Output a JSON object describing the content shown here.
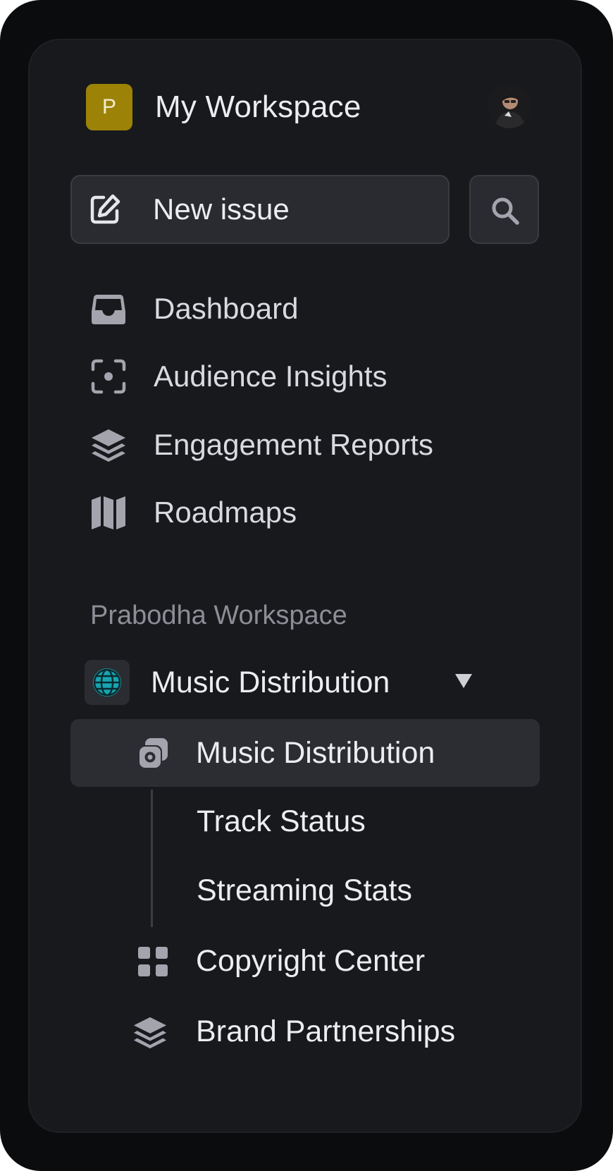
{
  "workspace": {
    "logo_letter": "P",
    "title": "My Workspace"
  },
  "toolbar": {
    "new_issue_label": "New issue"
  },
  "nav": {
    "items": [
      {
        "label": "Dashboard",
        "icon": "inbox-icon"
      },
      {
        "label": "Audience Insights",
        "icon": "focus-icon"
      },
      {
        "label": "Engagement Reports",
        "icon": "layers-icon"
      },
      {
        "label": "Roadmaps",
        "icon": "map-icon"
      }
    ]
  },
  "section": {
    "title": "Prabodha Workspace",
    "team": {
      "label": "Music Distribution",
      "icon": "globe-icon",
      "expanded": true
    },
    "items": [
      {
        "label": "Music Distribution",
        "icon": "copy-circle-icon",
        "active": true
      },
      {
        "label": "Track Status"
      },
      {
        "label": "Streaming Stats"
      },
      {
        "label": "Copyright Center",
        "icon": "grid-icon"
      },
      {
        "label": "Brand Partnerships",
        "icon": "layers-icon"
      }
    ]
  },
  "colors": {
    "background": "#0b0c0e",
    "panel": "#18191c",
    "accent_logo": "#9c8307",
    "active_item": "#2c2d33",
    "globe": "#1aa7b3",
    "text": "#ecedf1",
    "muted": "#8c8d96"
  }
}
